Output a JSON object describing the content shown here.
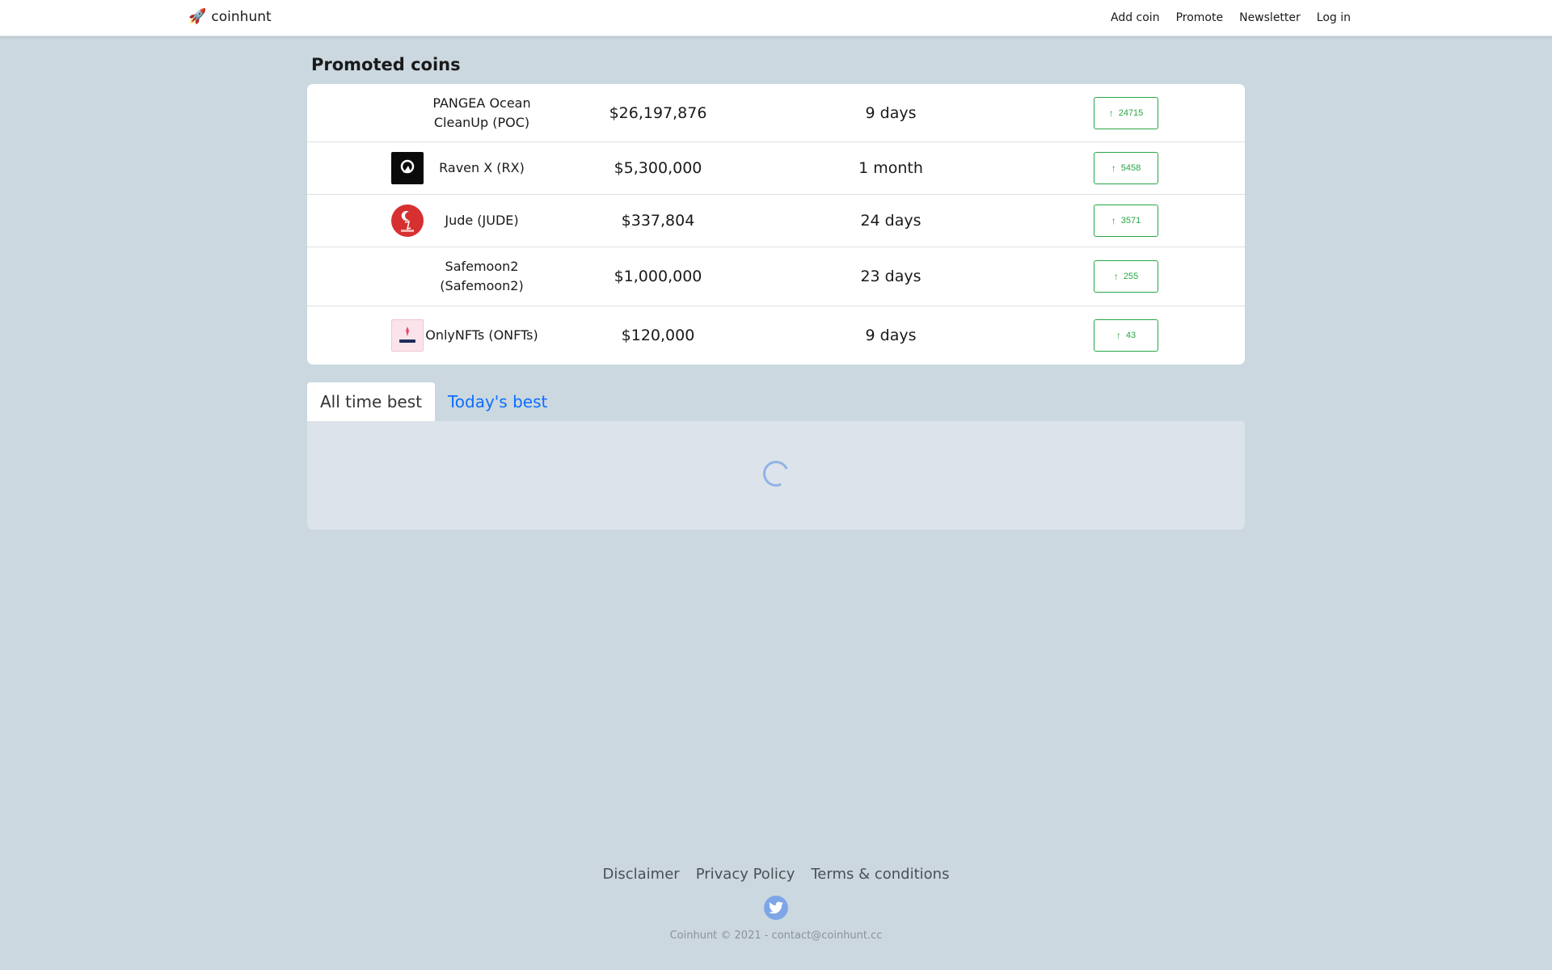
{
  "navbar": {
    "brand_icon": "rocket-icon",
    "brand": "coinhunt",
    "links": [
      "Add coin",
      "Promote",
      "Newsletter",
      "Log in"
    ]
  },
  "promoted": {
    "title": "Promoted coins",
    "coins": [
      {
        "name": "PANGEA Ocean CleanUp (POC)",
        "market_cap": "$26,197,876",
        "age": "9 days",
        "votes": "24715",
        "logo": "none"
      },
      {
        "name": "Raven X (RX)",
        "market_cap": "$5,300,000",
        "age": "1 month",
        "votes": "5458",
        "logo": "raven-x-logo"
      },
      {
        "name": "Jude (JUDE)",
        "market_cap": "$337,804",
        "age": "24 days",
        "votes": "3571",
        "logo": "jude-logo"
      },
      {
        "name": "Safemoon2 (Safemoon2)",
        "market_cap": "$1,000,000",
        "age": "23 days",
        "votes": "255",
        "logo": "none"
      },
      {
        "name": "OnlyNFTs (ONFTs)",
        "market_cap": "$120,000",
        "age": "9 days",
        "votes": "43",
        "logo": "onlynfts-logo"
      }
    ]
  },
  "tabs": [
    {
      "label": "All time best",
      "active": true
    },
    {
      "label": "Today's best",
      "active": false
    }
  ],
  "footer": {
    "links": [
      "Disclaimer",
      "Privacy Policy",
      "Terms & conditions"
    ],
    "social_icon": "twitter-icon",
    "copyright": "Coinhunt © 2021 - contact@coinhunt.cc"
  },
  "colors": {
    "page_background": "#cbd8e0",
    "vote_green": "#28a745",
    "tab_link_blue": "#0d6efd",
    "twitter_blue": "#7ea6e6"
  }
}
